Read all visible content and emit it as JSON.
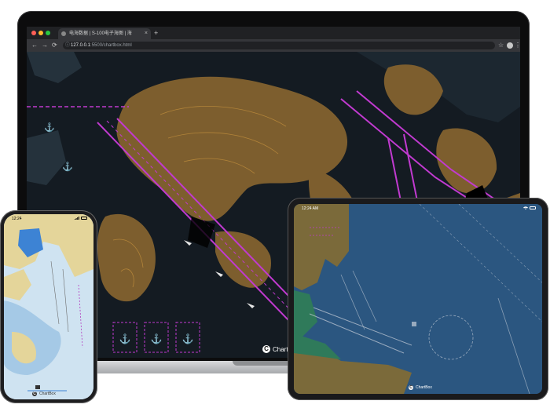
{
  "laptop": {
    "browser": {
      "tab_title": "电海数据 | S-100电子海图 | 海",
      "tab_close": "×",
      "new_tab": "+",
      "back": "←",
      "forward": "→",
      "reload": "⟳",
      "url_host": "127.0.0.1",
      "url_path": ":5500/chartbox.html",
      "star": "☆",
      "more": "⋮"
    },
    "brand": {
      "name": "ChartBox"
    },
    "map_colors": {
      "water": "#141b22",
      "land": "#7d5e2e",
      "channel": "#c13ad0"
    }
  },
  "tablet": {
    "status": {
      "time": "12:24 AM"
    },
    "brand": {
      "name": "ChartBox"
    },
    "map_colors": {
      "water": "#2b5680",
      "land": "#7b6a3a",
      "shallow": "#2f7a5a"
    }
  },
  "phone": {
    "status": {
      "time": "12:24"
    },
    "brand": {
      "name": "ChartBox"
    },
    "map_colors": {
      "water": "#cfe3f1",
      "land": "#e4d59a",
      "deep": "#a5c9e6"
    }
  }
}
